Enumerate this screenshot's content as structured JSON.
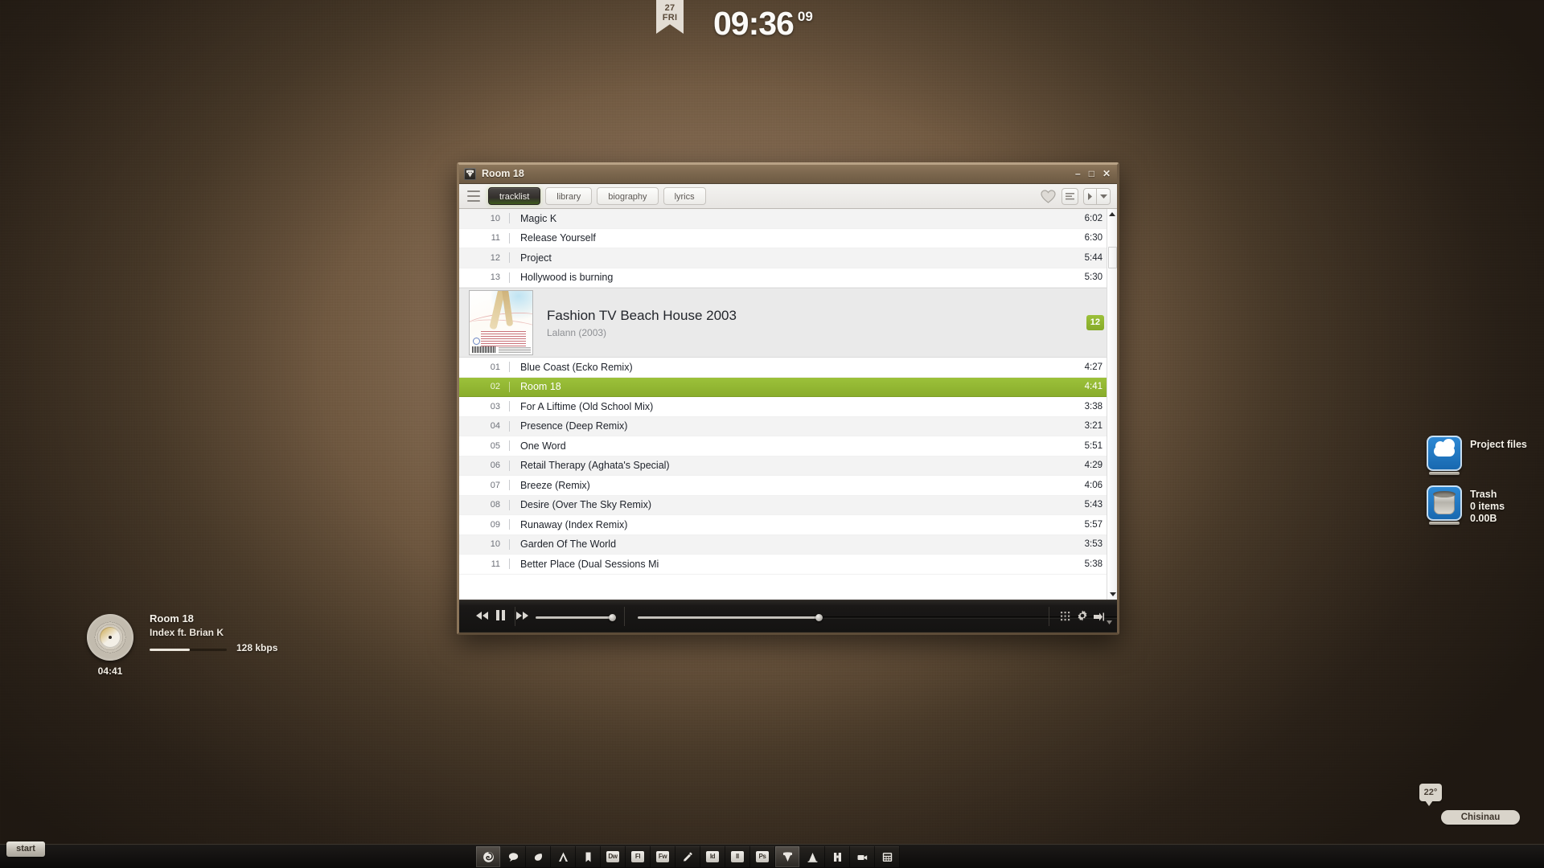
{
  "desktop": {
    "clock": {
      "day_num": "27",
      "day_name": "FRI",
      "time": "09:36",
      "seconds": "09"
    },
    "now_playing_widget": {
      "title": "Room 18",
      "artist": "Index ft. Brian K",
      "elapsed": "04:41",
      "bitrate": "128 kbps",
      "progress_percent": 52
    },
    "icons": [
      {
        "name": "Project files",
        "line2": "",
        "line3": "",
        "icon": "cloud-icon"
      },
      {
        "name": "Trash",
        "line2": "0 items",
        "line3": "0.00B",
        "icon": "trash-icon"
      }
    ],
    "weather": {
      "temperature": "22°",
      "city": "Chisinau"
    },
    "taskbar": {
      "start_label": "start",
      "buttons": [
        {
          "icon": "firefox-icon",
          "label": "",
          "active": true
        },
        {
          "icon": "chat-bubble-icon",
          "label": ""
        },
        {
          "icon": "leaf-icon",
          "label": ""
        },
        {
          "icon": "after-effects-icon",
          "label": ""
        },
        {
          "icon": "bookmark-icon",
          "label": ""
        },
        {
          "icon": "dreamweaver-icon",
          "label": "Dw"
        },
        {
          "icon": "flash-icon",
          "label": "Fl"
        },
        {
          "icon": "fireworks-icon",
          "label": "Fw"
        },
        {
          "icon": "color-picker-icon",
          "label": ""
        },
        {
          "icon": "indesign-icon",
          "label": "Id"
        },
        {
          "icon": "illustrator-icon",
          "label": "Il"
        },
        {
          "icon": "photoshop-icon",
          "label": "Ps"
        },
        {
          "icon": "music-player-icon",
          "label": "",
          "active": true
        },
        {
          "icon": "cone-icon",
          "label": ""
        },
        {
          "icon": "binoculars-icon",
          "label": ""
        },
        {
          "icon": "camcorder-icon",
          "label": ""
        },
        {
          "icon": "calculator-icon",
          "label": ""
        }
      ]
    }
  },
  "window": {
    "title": "Room 18",
    "controls": {
      "minimize": "–",
      "maximize": "□",
      "close": "✕"
    },
    "tabs": [
      {
        "label": "tracklist",
        "selected": true
      },
      {
        "label": "library",
        "selected": false
      },
      {
        "label": "biography",
        "selected": false
      },
      {
        "label": "lyrics",
        "selected": false
      }
    ],
    "toolbar_icons": [
      "menu-icon",
      "heart-icon",
      "list-view-icon",
      "next-icon",
      "chevron-down-icon"
    ],
    "top_tracks": [
      {
        "no": "10",
        "title": "Magic K",
        "dur": "6:02"
      },
      {
        "no": "11",
        "title": "Release Yourself",
        "dur": "6:30"
      },
      {
        "no": "12",
        "title": "Project",
        "dur": "5:44"
      },
      {
        "no": "13",
        "title": "Hollywood is burning",
        "dur": "5:30"
      }
    ],
    "album": {
      "title": "Fashion TV Beach House 2003",
      "subtitle": "Lalann (2003)",
      "track_count": "12"
    },
    "tracks": [
      {
        "no": "01",
        "title": "Blue Coast (Ecko Remix)",
        "dur": "4:27",
        "selected": false
      },
      {
        "no": "02",
        "title": "Room 18",
        "dur": "4:41",
        "selected": true
      },
      {
        "no": "03",
        "title": "For A Liftime (Old School Mix)",
        "dur": "3:38",
        "selected": false
      },
      {
        "no": "04",
        "title": "Presence (Deep Remix)",
        "dur": "3:21",
        "selected": false
      },
      {
        "no": "05",
        "title": "One Word",
        "dur": "5:51",
        "selected": false
      },
      {
        "no": "06",
        "title": "Retail Therapy (Aghata's Special)",
        "dur": "4:29",
        "selected": false
      },
      {
        "no": "07",
        "title": "Breeze (Remix)",
        "dur": "4:06",
        "selected": false
      },
      {
        "no": "08",
        "title": "Desire (Over The Sky Remix)",
        "dur": "5:43",
        "selected": false
      },
      {
        "no": "09",
        "title": "Runaway (Index Remix)",
        "dur": "5:57",
        "selected": false
      },
      {
        "no": "10",
        "title": "Garden Of The World",
        "dur": "3:53",
        "selected": false
      },
      {
        "no": "11",
        "title": "Better Place (Dual Sessions Mi",
        "dur": "5:38",
        "selected": false
      }
    ],
    "player": {
      "buttons": [
        "previous-button",
        "pause-button",
        "next-button"
      ],
      "volume_percent": 100,
      "seek_percent": 32,
      "right_icons": [
        "grid-icon",
        "settings-gear-icon",
        "playlist-end-icon",
        "chevron-down-icon"
      ]
    }
  },
  "colors": {
    "accent_green": "#9cc13a",
    "desktop_brown": "#8a7157",
    "window_chrome": "#7c674e",
    "panel_dark": "#1a1817"
  }
}
